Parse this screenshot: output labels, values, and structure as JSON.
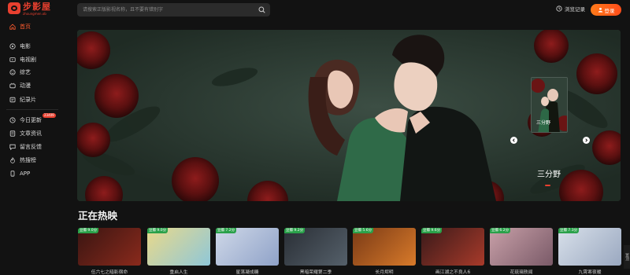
{
  "logo": {
    "name": "步影屋",
    "subtitle": "zhoungmen.ob"
  },
  "search": {
    "placeholder": "请搜索正版影视名称，且不要有错别字"
  },
  "header": {
    "history_label": "浏览记录",
    "login_label": "登录"
  },
  "sidebar": {
    "items": [
      {
        "label": "首页",
        "icon": "home-icon",
        "active": true
      },
      {
        "label": "电影",
        "icon": "film-icon"
      },
      {
        "label": "电视剧",
        "icon": "tv-icon"
      },
      {
        "label": "综艺",
        "icon": "variety-icon"
      },
      {
        "label": "动漫",
        "icon": "anime-icon"
      },
      {
        "label": "纪录片",
        "icon": "documentary-icon"
      },
      {
        "label": "今日更新",
        "icon": "clock-icon",
        "badge": "23409"
      },
      {
        "label": "文章资讯",
        "icon": "article-icon"
      },
      {
        "label": "留言反馈",
        "icon": "message-icon"
      },
      {
        "label": "热搜榜",
        "icon": "fire-icon"
      },
      {
        "label": "APP",
        "icon": "app-icon"
      }
    ]
  },
  "banner": {
    "title": "三分野",
    "thumb_text": "三分野"
  },
  "section": {
    "title": "正在热映"
  },
  "cards": [
    {
      "rating": "豆瓣 9.0分",
      "name": "伍六七之暗影宿命",
      "colors": [
        "#3a1512",
        "#8a2a1c"
      ]
    },
    {
      "rating": "豆瓣 9.0分",
      "name": "重启人生",
      "colors": [
        "#e9d98a",
        "#8fc7d8"
      ]
    },
    {
      "rating": "豆瓣 7.2分",
      "name": "星落凝成糖",
      "colors": [
        "#cfd8e8",
        "#8fa2c8"
      ]
    },
    {
      "rating": "豆瓣 9.2分",
      "name": "黑暗荣耀第二季",
      "colors": [
        "#2a2f36",
        "#55606a"
      ]
    },
    {
      "rating": "豆瓣 5.6分",
      "name": "长月烬明",
      "colors": [
        "#7a3a16",
        "#d87a2a"
      ]
    },
    {
      "rating": "豆瓣 9.6分",
      "name": "画江湖之不良人6",
      "colors": [
        "#3a1a1a",
        "#a83a2a"
      ]
    },
    {
      "rating": "豆瓣 6.2分",
      "name": "花琉璃轶闻",
      "colors": [
        "#c8a0a8",
        "#7a5a68"
      ]
    },
    {
      "rating": "豆瓣 7.3分",
      "name": "九霄寒夜暖",
      "colors": [
        "#d8e0ea",
        "#9aa8c0"
      ]
    }
  ],
  "side_tab": {
    "label": "置顶"
  }
}
